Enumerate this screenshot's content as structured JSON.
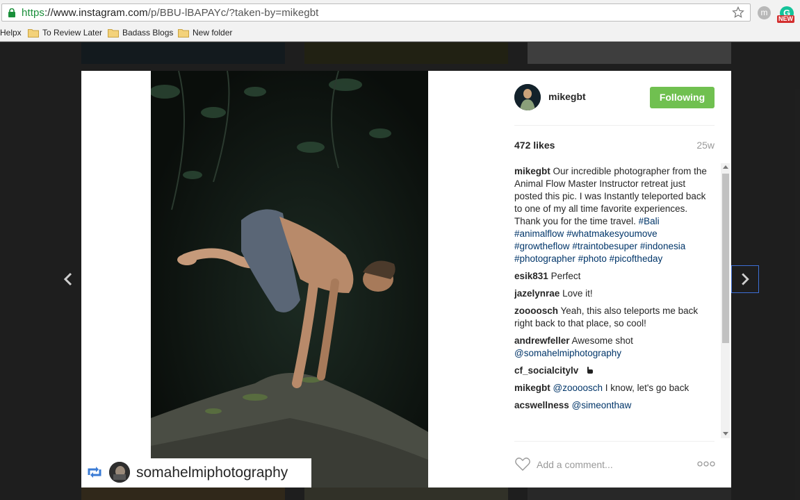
{
  "browser": {
    "url_scheme": "https",
    "url_host": "://www.instagram.com",
    "url_path": "/p/BBU-lBAPAYc/?taken-by=mikegbt",
    "extension_m_label": "m",
    "extension_g_label": "G",
    "extension_badge": "NEW"
  },
  "bookmarks": [
    {
      "label": "Helpx"
    },
    {
      "label": "To Review Later"
    },
    {
      "label": "Badass Blogs"
    },
    {
      "label": "New folder"
    }
  ],
  "post": {
    "username": "mikegbt",
    "follow_label": "Following",
    "likes": "472 likes",
    "age": "25w",
    "repost_credit": "somahelmiphotography",
    "comment_placeholder": "Add a comment...",
    "comments": [
      {
        "user": "mikegbt",
        "text": "Our incredible photographer from the Animal Flow Master Instructor retreat just posted this pic. I was Instantly teleported back to one of my all time favorite experiences. Thank you for the time travel.",
        "tags": [
          "#Bali",
          "#animalflow",
          "#whatmakesyoumove",
          "#growtheflow",
          "#traintobesuper",
          "#indonesia",
          "#photographer",
          "#photo",
          "#picoftheday"
        ]
      },
      {
        "user": "esik831",
        "text": "Perfect"
      },
      {
        "user": "jazelynrae",
        "text": "Love it!"
      },
      {
        "user": "zoooosch",
        "text": "Yeah, this also teleports me back right back to that place, so cool!"
      },
      {
        "user": "andrewfeller",
        "text": "Awesome shot",
        "mention": "@somahelmiphotography"
      },
      {
        "user": "cf_socialcitylv",
        "text": ""
      },
      {
        "user": "mikegbt",
        "mention": "@zoooosch",
        "text": "I know, let's go back"
      },
      {
        "user": "acswellness",
        "mention": "@simeonthaw",
        "text": ""
      }
    ]
  },
  "colors": {
    "follow_button": "#70c050",
    "hashtag": "#003569",
    "url_secure": "#1a8f3a"
  }
}
